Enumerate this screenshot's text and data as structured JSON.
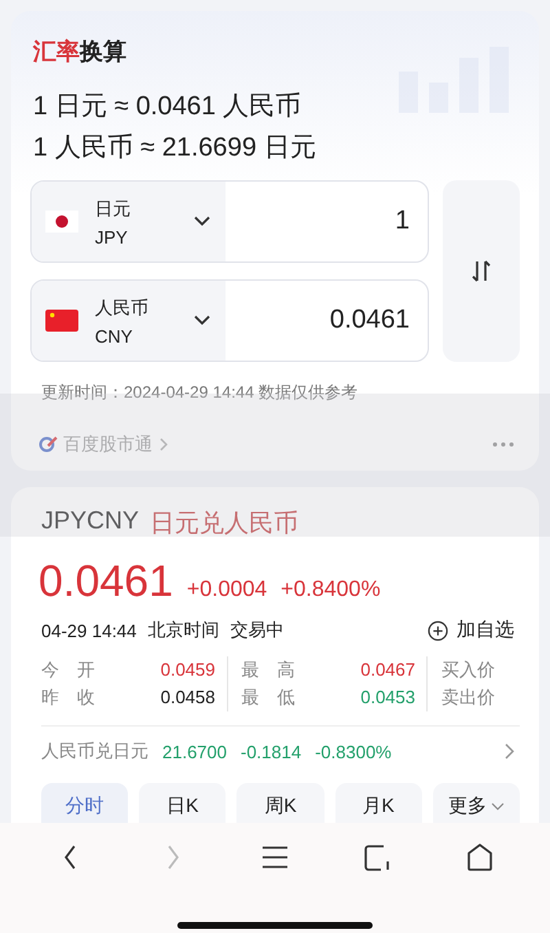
{
  "converter": {
    "title_accent": "汇率",
    "title_rest": "换算",
    "rates": [
      "1 日元 ≈ 0.0461 人民币",
      "1 人民币 ≈ 21.6699 日元"
    ],
    "currencies": [
      {
        "name": "日元",
        "code": "JPY",
        "kind": "japan",
        "amount": "1"
      },
      {
        "name": "人民币",
        "code": "CNY",
        "kind": "china",
        "amount": "0.0461"
      }
    ],
    "updated": "更新时间：2024-04-29 14:44 数据仅供参考",
    "source": "百度股市通"
  },
  "quote": {
    "symbol": "JPYCNY",
    "pair": "日元兑人民币",
    "price": "0.0461",
    "change": "+0.0004",
    "change_pct": "+0.8400%",
    "color": "#d8343a",
    "time": "04-29 14:44",
    "zone": "北京时间",
    "status": "交易中",
    "watch": "加自选",
    "stats": [
      {
        "label": "今　开",
        "value": "0.0459",
        "color": "#d8343a"
      },
      {
        "label": "最　高",
        "value": "0.0467",
        "color": "#d8343a"
      },
      {
        "label": "买入价"
      },
      {
        "label": "昨　收",
        "value": "0.0458",
        "color": "#222222"
      },
      {
        "label": "最　低",
        "value": "0.0453",
        "color": "#23a06b"
      },
      {
        "label": "卖出价"
      }
    ],
    "inverse": {
      "pair": "人民币兑日元",
      "price": "21.6700",
      "change": "-0.1814",
      "change_pct": "-0.8300%",
      "color": "#23a06b"
    },
    "tabs": [
      {
        "label": "分时",
        "selected": true,
        "dropdown": false
      },
      {
        "label": "日K",
        "selected": false,
        "dropdown": false
      },
      {
        "label": "周K",
        "selected": false,
        "dropdown": false
      },
      {
        "label": "月K",
        "selected": false,
        "dropdown": false
      },
      {
        "label": "更多",
        "selected": false,
        "dropdown": true
      }
    ]
  },
  "nav": [
    {
      "kind": "back",
      "disabled": false
    },
    {
      "kind": "forward",
      "disabled": true
    },
    {
      "kind": "menu",
      "disabled": false
    },
    {
      "kind": "tabs",
      "disabled": false
    },
    {
      "kind": "home",
      "disabled": false
    }
  ]
}
